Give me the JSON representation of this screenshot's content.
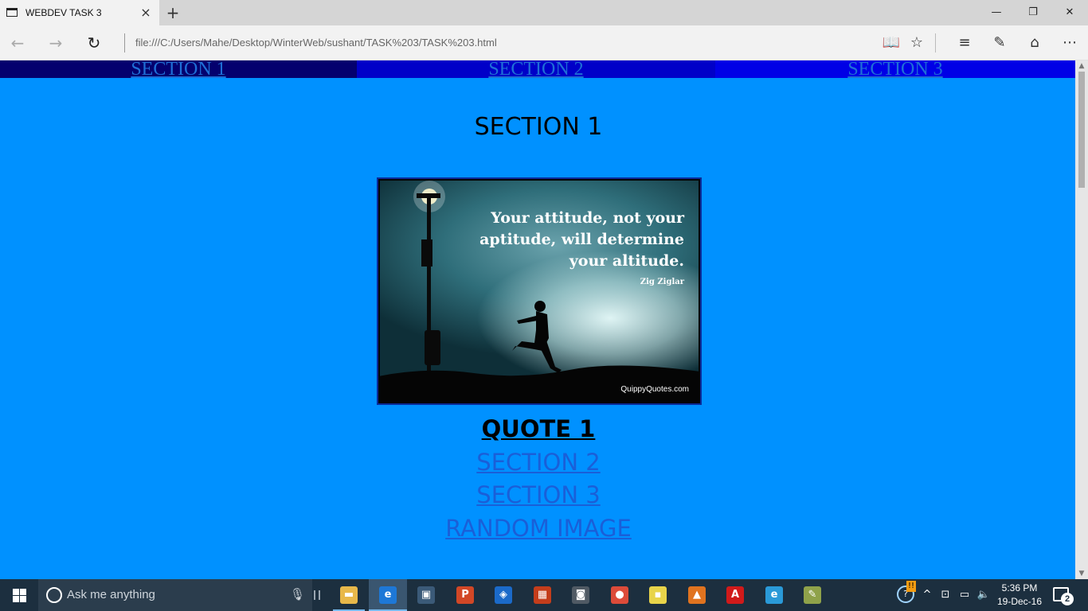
{
  "browser": {
    "tab_title": "WEBDEV TASK 3",
    "tab_close_icon": "×",
    "new_tab_icon": "+",
    "address": "file:///C:/Users/Mahe/Desktop/WinterWeb/sushant/TASK%203/TASK%203.html",
    "minimize_icon": "—",
    "restore_icon": "❐",
    "close_icon": "✕",
    "back_icon": "←",
    "forward_icon": "→",
    "refresh_icon": "↻",
    "reading_view_icon": "📖",
    "favorite_icon": "☆",
    "hub_icon": "≡",
    "web_note_icon": "✎",
    "share_icon": "⌂",
    "more_icon": "⋯"
  },
  "page": {
    "nav": [
      "SECTION 1",
      "SECTION 2",
      "SECTION 3"
    ],
    "title": "SECTION 1",
    "image": {
      "lines": [
        "Your attitude, not your",
        "aptitude, will determine",
        "your altitude."
      ],
      "author": "Zig Ziglar",
      "site": "QuippyQuotes.com"
    },
    "quote_heading": "QUOTE 1",
    "links": [
      "SECTION 2",
      "SECTION 3",
      "RANDOM IMAGE"
    ]
  },
  "taskbar": {
    "search_placeholder": "Ask me anything",
    "clock_time": "5:36 PM",
    "clock_date": "19-Dec-16",
    "notification_count": "2",
    "apps": [
      {
        "name": "file-explorer",
        "glyph": "▬",
        "color": "#e8b84a"
      },
      {
        "name": "edge",
        "glyph": "e",
        "color": "#1e78d7"
      },
      {
        "name": "store",
        "glyph": "▣",
        "color": "#3b5a78"
      },
      {
        "name": "powerpoint",
        "glyph": "P",
        "color": "#d24726"
      },
      {
        "name": "defender",
        "glyph": "◈",
        "color": "#1b6ac9"
      },
      {
        "name": "office",
        "glyph": "▦",
        "color": "#c43d1b"
      },
      {
        "name": "camera",
        "glyph": "◙",
        "color": "#505a64"
      },
      {
        "name": "chrome",
        "glyph": "●",
        "color": "#dd4b39"
      },
      {
        "name": "sticky-notes",
        "glyph": "▪",
        "color": "#e8d44a"
      },
      {
        "name": "matlab",
        "glyph": "▲",
        "color": "#e0731f"
      },
      {
        "name": "acrobat",
        "glyph": "A",
        "color": "#d11a1a"
      },
      {
        "name": "internet-explorer",
        "glyph": "e",
        "color": "#2a9ad8"
      },
      {
        "name": "paint",
        "glyph": "✎",
        "color": "#8fa24a"
      }
    ]
  },
  "colors": {
    "page_background": "#0091ff",
    "nav_1": "#04006e",
    "nav_2": "#0000c8",
    "nav_3": "#0000e6",
    "link": "#1a5fd8",
    "taskbar": "#1c2f3f"
  }
}
